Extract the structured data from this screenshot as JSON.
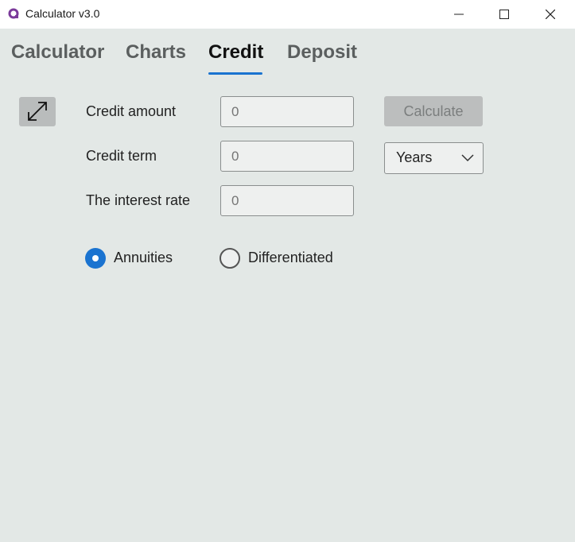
{
  "window": {
    "title": "Calculator v3.0",
    "app_icon": "app-logo-icon",
    "controls": [
      "minimize-icon",
      "maximize-icon",
      "close-icon"
    ]
  },
  "tabs": [
    {
      "label": "Calculator",
      "active": false
    },
    {
      "label": "Charts",
      "active": false
    },
    {
      "label": "Credit",
      "active": true
    },
    {
      "label": "Deposit",
      "active": false
    }
  ],
  "credit": {
    "expand_icon": "expand-arrows-icon",
    "amount_label": "Credit amount",
    "amount_placeholder": "0",
    "term_label": "Credit term",
    "term_placeholder": "0",
    "rate_label": "The interest rate",
    "rate_placeholder": "0",
    "calculate_label": "Calculate",
    "term_unit": "Years",
    "payment_types": [
      {
        "label": "Annuities",
        "checked": true
      },
      {
        "label": "Differentiated",
        "checked": false
      }
    ]
  },
  "colors": {
    "accent": "#1a73d0",
    "background": "#e3e8e6",
    "titlebar": "#ffffff",
    "app_icon": "#7a3a9a"
  }
}
